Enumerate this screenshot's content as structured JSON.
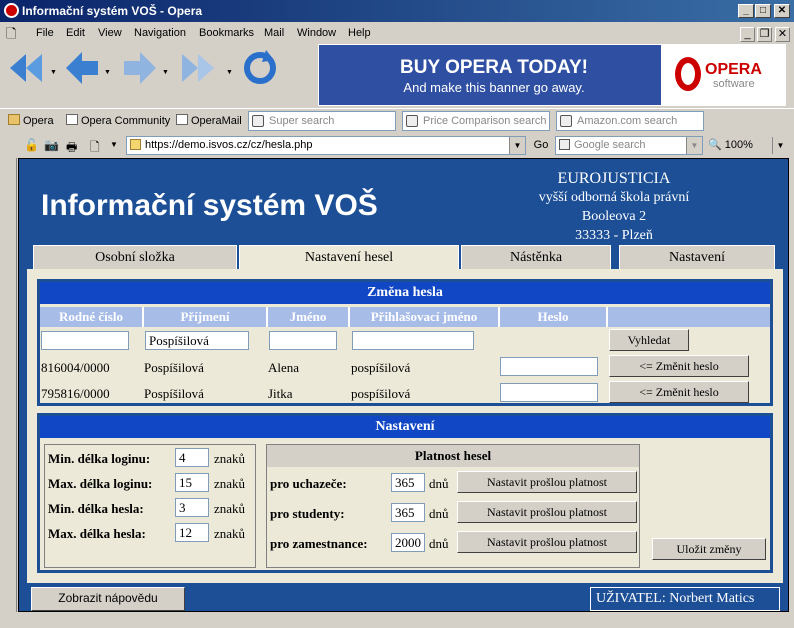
{
  "window": {
    "title": "Informační systém VOŠ - Opera"
  },
  "menu": [
    "File",
    "Edit",
    "View",
    "Navigation",
    "Bookmarks",
    "Mail",
    "Window",
    "Help"
  ],
  "banner": {
    "headline": "BUY OPERA TODAY!",
    "subline": "And make this banner go away.",
    "logo_top": "OPERA",
    "logo_bottom": "software"
  },
  "bookmarks": [
    "Opera",
    "Opera Community",
    "OperaMail"
  ],
  "searches": [
    "Super search",
    "Price Comparison search",
    "Amazon.com search"
  ],
  "address": {
    "url": "https://demo.isvos.cz/cz/hesla.php",
    "go": "Go",
    "search_placeholder": "Google search",
    "zoom": "100%"
  },
  "page": {
    "title": "Informační systém VOŠ",
    "school": [
      "EUROJUSTICIA",
      "vyšší odborná škola právní",
      "Booleova 2",
      "33333 - Plzeň"
    ]
  },
  "tabs": [
    "Osobní složka",
    "Nastavení hesel",
    "Nástěnka",
    "Nastavení"
  ],
  "password_change": {
    "title": "Změna hesla",
    "columns": [
      "Rodné číslo",
      "Příjmení",
      "Jméno",
      "Přihlašovací jméno",
      "Heslo"
    ],
    "filter": {
      "rodne_cislo": "",
      "prijmeni": "Pospíšilová",
      "jmeno": "",
      "login": ""
    },
    "search_button": "Vyhledat",
    "rows": [
      {
        "rc": "816004/0000",
        "prijmeni": "Pospíšilová",
        "jmeno": "Alena",
        "login": "pospíšilová",
        "heslo": "",
        "button": "<= Změnit heslo"
      },
      {
        "rc": "795816/0000",
        "prijmeni": "Pospíšilová",
        "jmeno": "Jitka",
        "login": "pospíšilová",
        "heslo": "",
        "button": "<= Změnit heslo"
      }
    ]
  },
  "settings": {
    "title": "Nastavení",
    "limits": [
      {
        "label": "Min. délka loginu:",
        "value": "4",
        "unit": "znaků"
      },
      {
        "label": "Max. délka loginu:",
        "value": "15",
        "unit": "znaků"
      },
      {
        "label": "Min. délka hesla:",
        "value": "3",
        "unit": "znaků"
      },
      {
        "label": "Max. délka hesla:",
        "value": "12",
        "unit": "znaků"
      }
    ],
    "validity": {
      "title": "Platnost hesel",
      "rows": [
        {
          "label": "pro uchazeče:",
          "value": "365",
          "unit": "dnů",
          "button": "Nastavit prošlou platnost"
        },
        {
          "label": "pro studenty:",
          "value": "365",
          "unit": "dnů",
          "button": "Nastavit prošlou platnost"
        },
        {
          "label": "pro zamestnance:",
          "value": "2000",
          "unit": "dnů",
          "button": "Nastavit prošlou platnost"
        }
      ]
    },
    "save_button": "Uložit změny"
  },
  "footer": {
    "help_button": "Zobrazit nápovědu",
    "user": "UŽIVATEL: Norbert Matics"
  }
}
